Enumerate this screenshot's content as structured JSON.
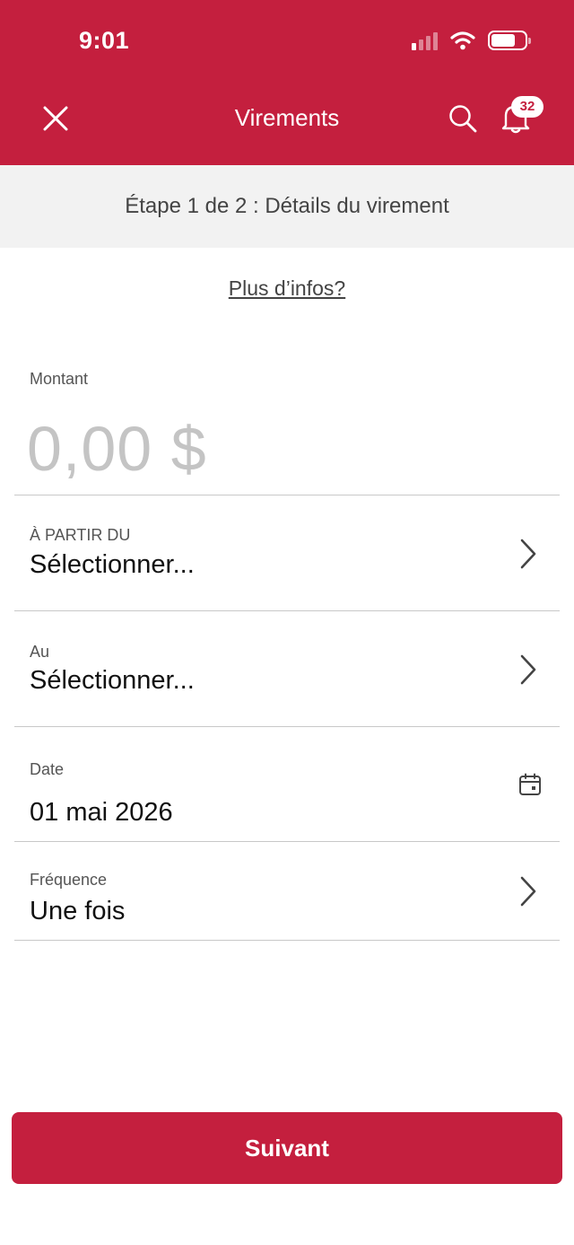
{
  "status_bar": {
    "time": "9:01"
  },
  "header": {
    "title": "Virements",
    "notification_count": "32"
  },
  "step": {
    "text": "Étape 1 de 2 : Détails du virement"
  },
  "more_info": {
    "label": "Plus d’infos?"
  },
  "form": {
    "amount": {
      "label": "Montant",
      "placeholder": "0,00 $"
    },
    "from": {
      "label": "À PARTIR DU",
      "value": "Sélectionner..."
    },
    "to": {
      "label": "Au",
      "value": "Sélectionner..."
    },
    "date": {
      "label": "Date",
      "value": "01 mai 2026"
    },
    "frequency": {
      "label": "Fréquence",
      "value": "Une fois"
    }
  },
  "actions": {
    "next_label": "Suivant"
  },
  "colors": {
    "brand": "#c41f3e",
    "step_bar_bg": "#f2f2f2",
    "placeholder": "#c4c4c4",
    "divider": "#c8c8c8"
  },
  "icons": [
    "close-icon",
    "search-icon",
    "bell-icon",
    "chevron-right-icon",
    "calendar-icon",
    "signal-icon",
    "wifi-icon",
    "battery-icon"
  ]
}
